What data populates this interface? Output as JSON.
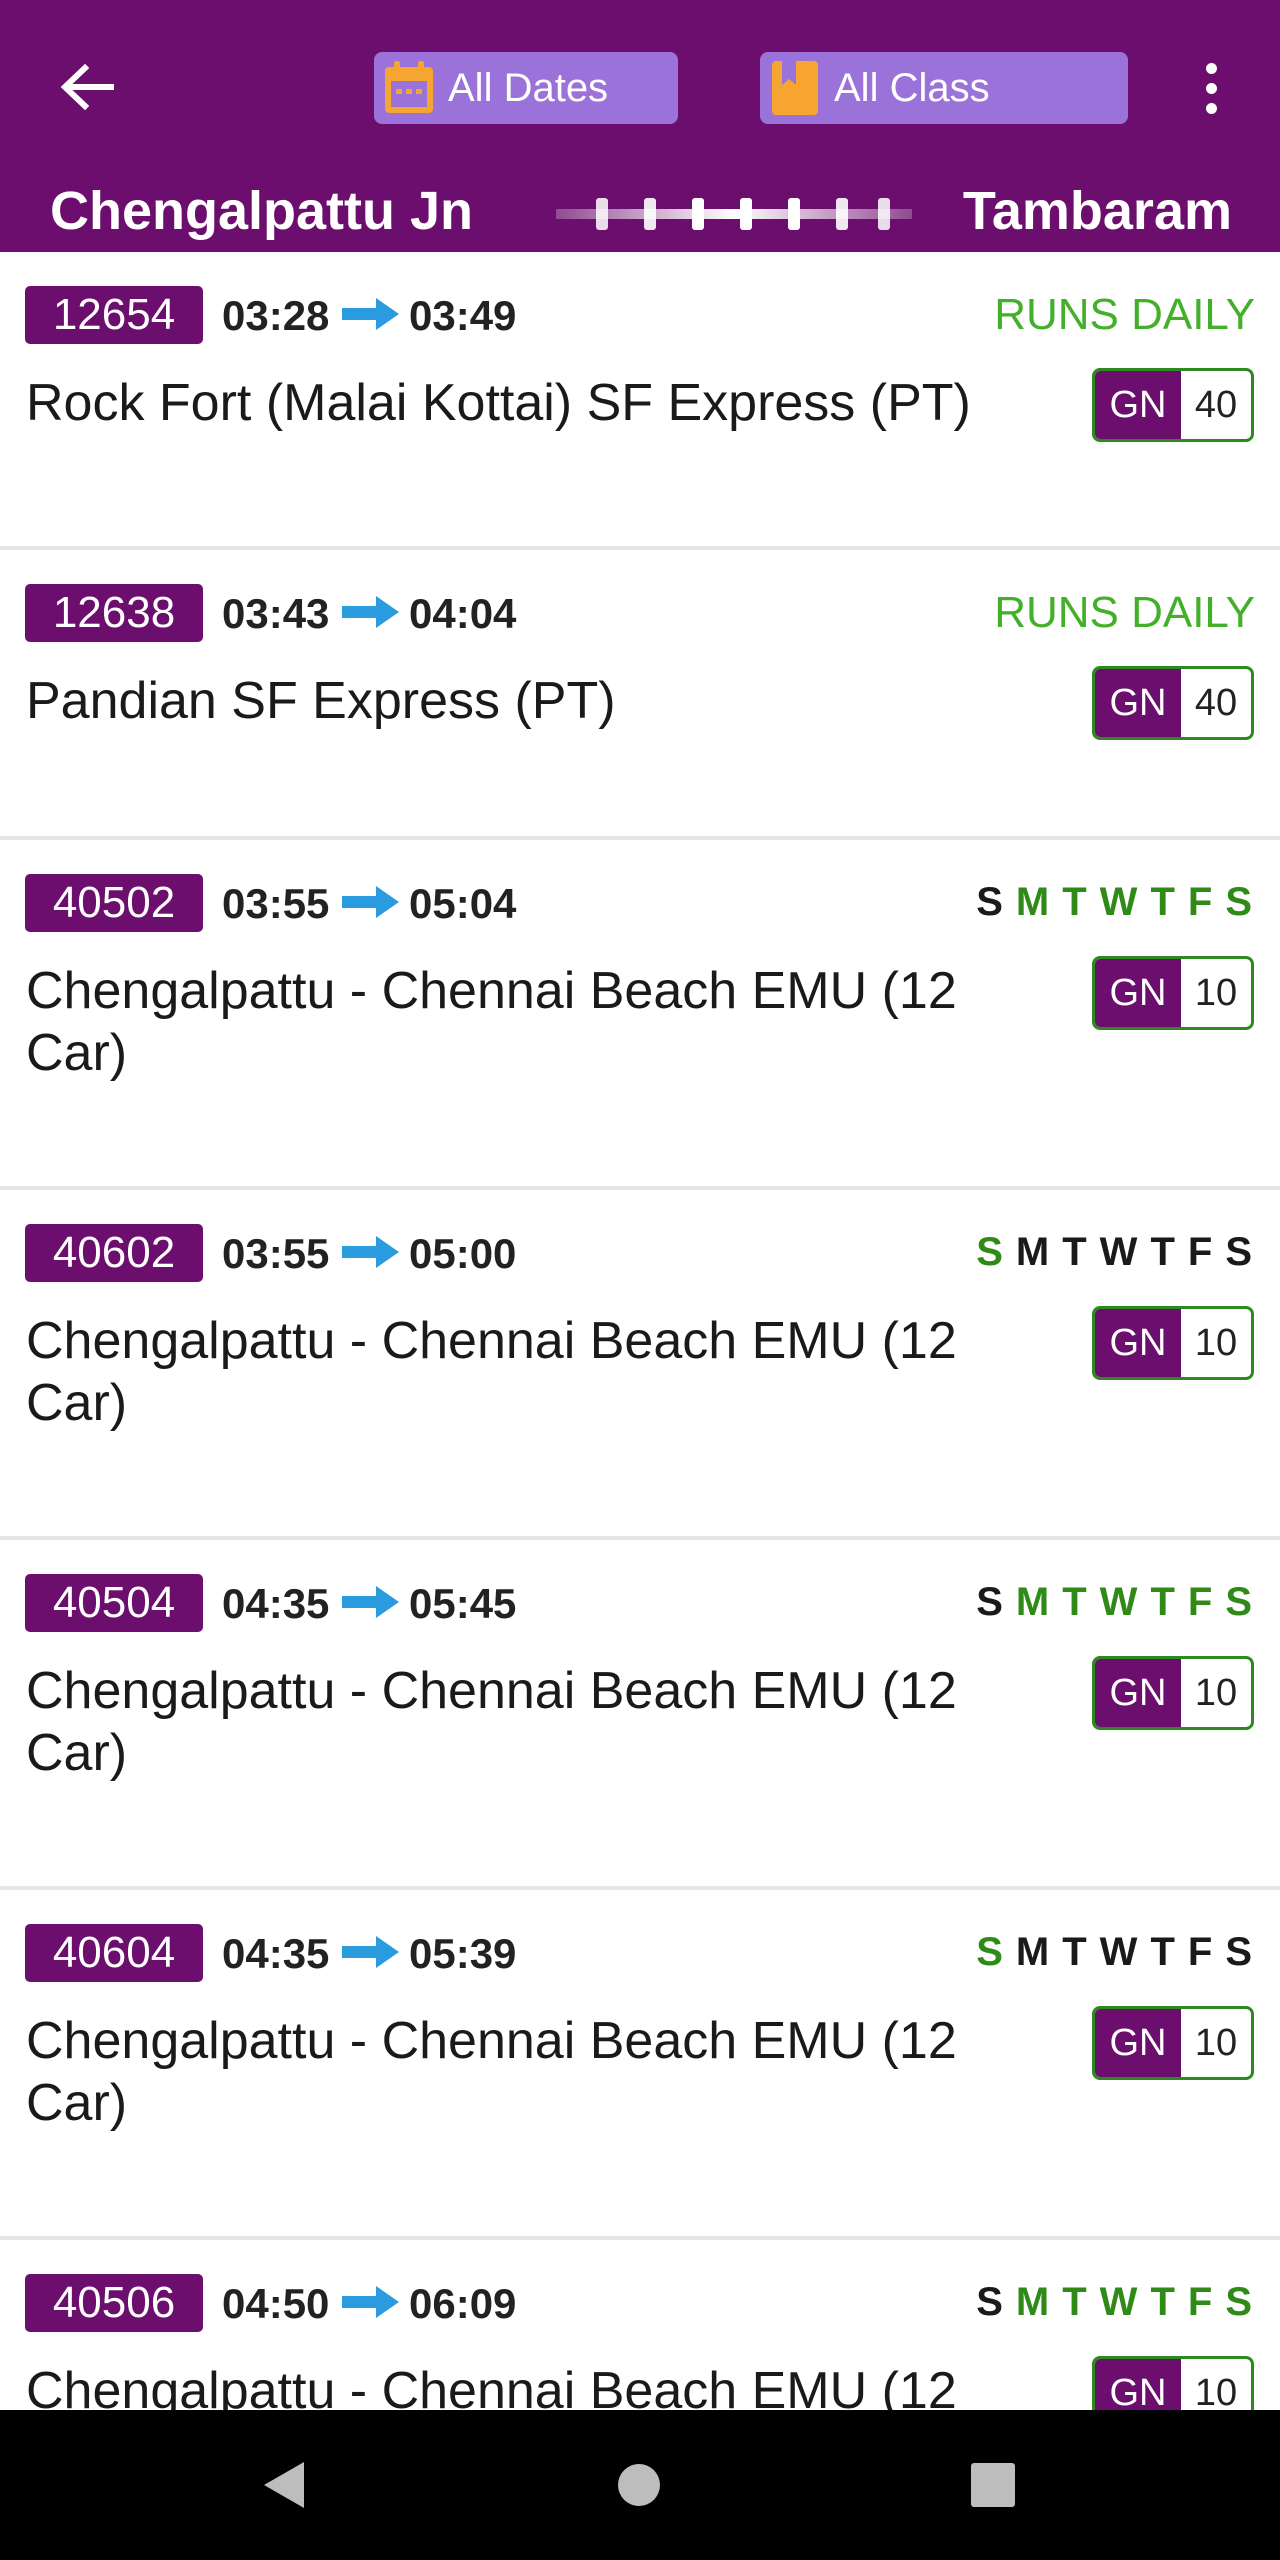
{
  "header": {
    "dates_label": "All Dates",
    "class_label": "All Class",
    "from_station": "Chengalpattu Jn",
    "to_station": "Tambaram"
  },
  "colors": {
    "primary": "#6c0e6d",
    "chip": "#9b72da",
    "runs_daily": "#43b02a",
    "day_on": "#2f8a17",
    "arrow": "#2b9be0"
  },
  "trains": [
    {
      "number": "12654",
      "dep": "03:28",
      "arr": "03:49",
      "runs": "RUNS DAILY",
      "name": "Rock Fort (Malai Kottai) SF Express (PT)",
      "class": "GN",
      "count": "40"
    },
    {
      "number": "12638",
      "dep": "03:43",
      "arr": "04:04",
      "runs": "RUNS DAILY",
      "name": "Pandian SF Express (PT)",
      "class": "GN",
      "count": "40"
    },
    {
      "number": "40502",
      "dep": "03:55",
      "arr": "05:04",
      "name": "Chengalpattu - Chennai Beach EMU (12 Car)",
      "class": "GN",
      "count": "10",
      "days": [
        {
          "l": "S",
          "on": false
        },
        {
          "l": "M",
          "on": true
        },
        {
          "l": "T",
          "on": true
        },
        {
          "l": "W",
          "on": true
        },
        {
          "l": "T",
          "on": true
        },
        {
          "l": "F",
          "on": true
        },
        {
          "l": "S",
          "on": true
        }
      ]
    },
    {
      "number": "40602",
      "dep": "03:55",
      "arr": "05:00",
      "name": "Chengalpattu - Chennai Beach EMU (12 Car)",
      "class": "GN",
      "count": "10",
      "days": [
        {
          "l": "S",
          "on": true
        },
        {
          "l": "M",
          "on": false
        },
        {
          "l": "T",
          "on": false
        },
        {
          "l": "W",
          "on": false
        },
        {
          "l": "T",
          "on": false
        },
        {
          "l": "F",
          "on": false
        },
        {
          "l": "S",
          "on": false
        }
      ]
    },
    {
      "number": "40504",
      "dep": "04:35",
      "arr": "05:45",
      "name": "Chengalpattu - Chennai Beach EMU (12 Car)",
      "class": "GN",
      "count": "10",
      "days": [
        {
          "l": "S",
          "on": false
        },
        {
          "l": "M",
          "on": true
        },
        {
          "l": "T",
          "on": true
        },
        {
          "l": "W",
          "on": true
        },
        {
          "l": "T",
          "on": true
        },
        {
          "l": "F",
          "on": true
        },
        {
          "l": "S",
          "on": true
        }
      ]
    },
    {
      "number": "40604",
      "dep": "04:35",
      "arr": "05:39",
      "name": "Chengalpattu - Chennai Beach EMU (12 Car)",
      "class": "GN",
      "count": "10",
      "days": [
        {
          "l": "S",
          "on": true
        },
        {
          "l": "M",
          "on": false
        },
        {
          "l": "T",
          "on": false
        },
        {
          "l": "W",
          "on": false
        },
        {
          "l": "T",
          "on": false
        },
        {
          "l": "F",
          "on": false
        },
        {
          "l": "S",
          "on": false
        }
      ]
    },
    {
      "number": "40506",
      "dep": "04:50",
      "arr": "06:09",
      "name": "Chengalpattu - Chennai Beach EMU (12",
      "class": "GN",
      "count": "10",
      "days": [
        {
          "l": "S",
          "on": false
        },
        {
          "l": "M",
          "on": true
        },
        {
          "l": "T",
          "on": true
        },
        {
          "l": "W",
          "on": true
        },
        {
          "l": "T",
          "on": true
        },
        {
          "l": "F",
          "on": true
        },
        {
          "l": "S",
          "on": true
        }
      ]
    }
  ]
}
